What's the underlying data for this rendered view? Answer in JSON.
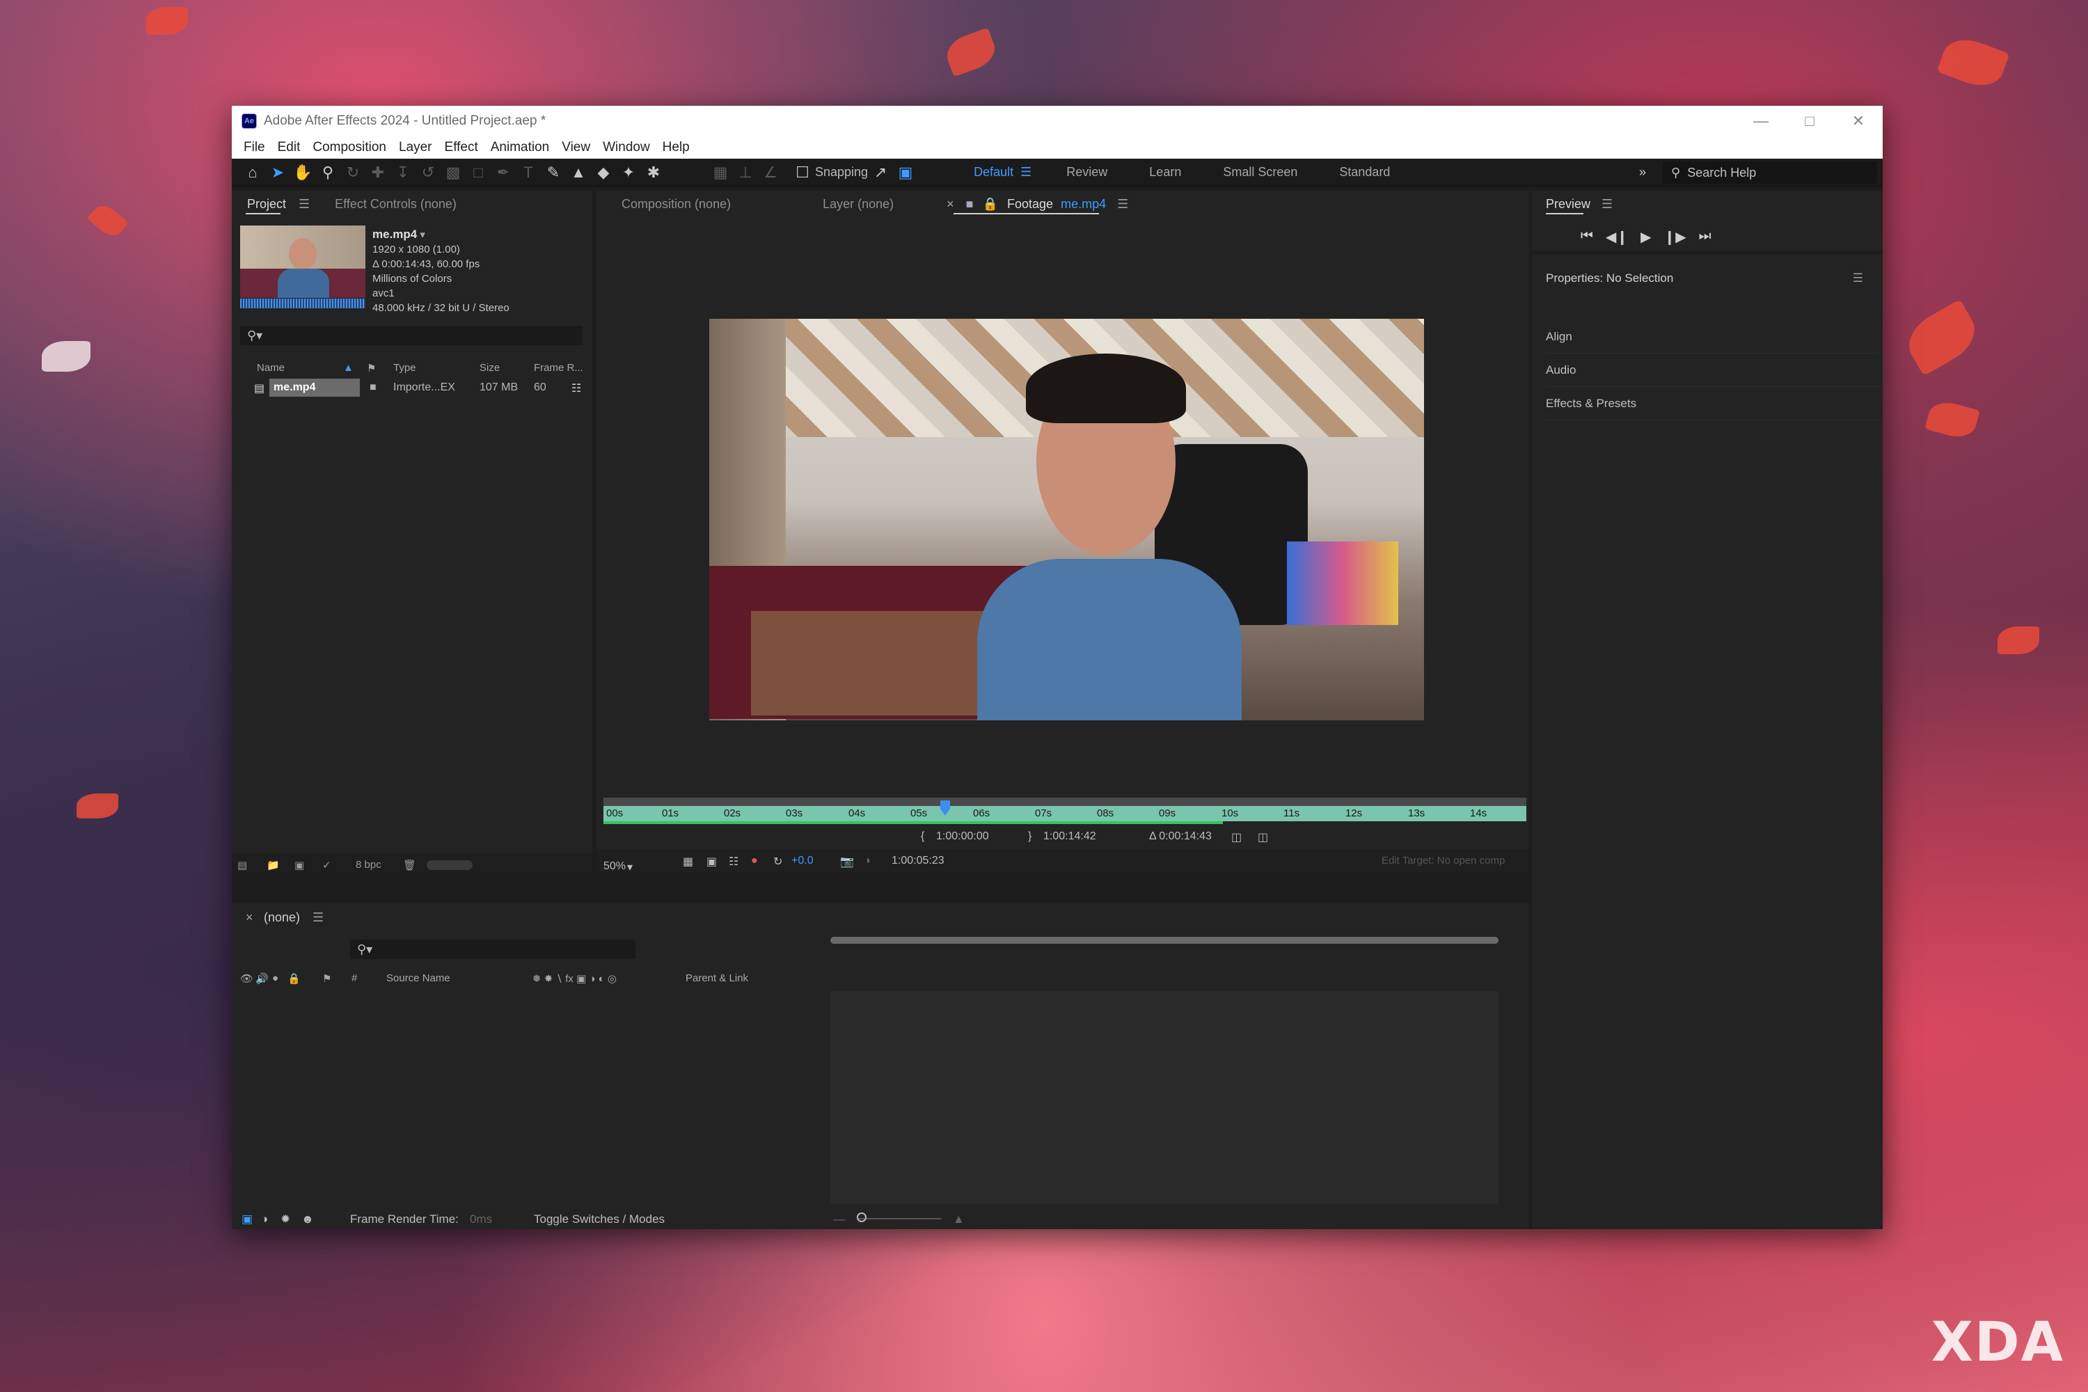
{
  "window": {
    "title": "Adobe After Effects 2024 - Untitled Project.aep *",
    "app_logo": "Ae"
  },
  "menu": [
    "File",
    "Edit",
    "Composition",
    "Layer",
    "Effect",
    "Animation",
    "View",
    "Window",
    "Help"
  ],
  "toolbar": {
    "snapping_label": "Snapping",
    "workspaces": [
      "Default",
      "Review",
      "Learn",
      "Small Screen",
      "Standard"
    ],
    "active_workspace": "Default",
    "search_help_placeholder": "Search Help"
  },
  "project_panel": {
    "tabs": [
      "Project",
      "Effect Controls (none)"
    ],
    "footage": {
      "name": "me.mp4",
      "resolution": "1920 x 1080 (1.00)",
      "duration": "Δ 0:00:14:43, 60.00 fps",
      "colors": "Millions of Colors",
      "codec": "avc1",
      "audio": "48.000 kHz / 32 bit U / Stereo"
    },
    "columns": [
      "Name",
      "Type",
      "Size",
      "Frame R..."
    ],
    "items": [
      {
        "name": "me.mp4",
        "type": "Importe...EX",
        "size": "107 MB",
        "frame_rate": "60"
      }
    ],
    "bpc": "8 bpc"
  },
  "viewer": {
    "tabs": [
      "Composition (none)",
      "Layer (none)"
    ],
    "footage_tab_prefix": "Footage",
    "footage_tab_name": "me.mp4",
    "ruler_ticks": [
      "00s",
      "01s",
      "02s",
      "03s",
      "04s",
      "05s",
      "06s",
      "07s",
      "08s",
      "09s",
      "10s",
      "11s",
      "12s",
      "13s",
      "14s"
    ],
    "in_point": "1:00:00:00",
    "out_point": "1:00:14:42",
    "duration": "Δ 0:00:14:43",
    "zoom": "50%",
    "exposure": "+0.0",
    "current_time": "1:00:05:23",
    "edit_target": "Edit Target: No open comp"
  },
  "right_panels": {
    "preview_title": "Preview",
    "properties_title": "Properties: No Selection",
    "items": [
      "Align",
      "Audio",
      "Effects & Presets"
    ]
  },
  "timeline": {
    "tab": "(none)",
    "col_source_name": "Source Name",
    "col_hash": "#",
    "col_parent": "Parent & Link",
    "frame_render_label": "Frame Render Time:",
    "frame_render_value": "0ms",
    "toggle_label": "Toggle Switches / Modes"
  },
  "watermark": "XDA",
  "colors": {
    "accent": "#3d9cff",
    "ruler": "#79c5ae",
    "panel": "#232323"
  }
}
